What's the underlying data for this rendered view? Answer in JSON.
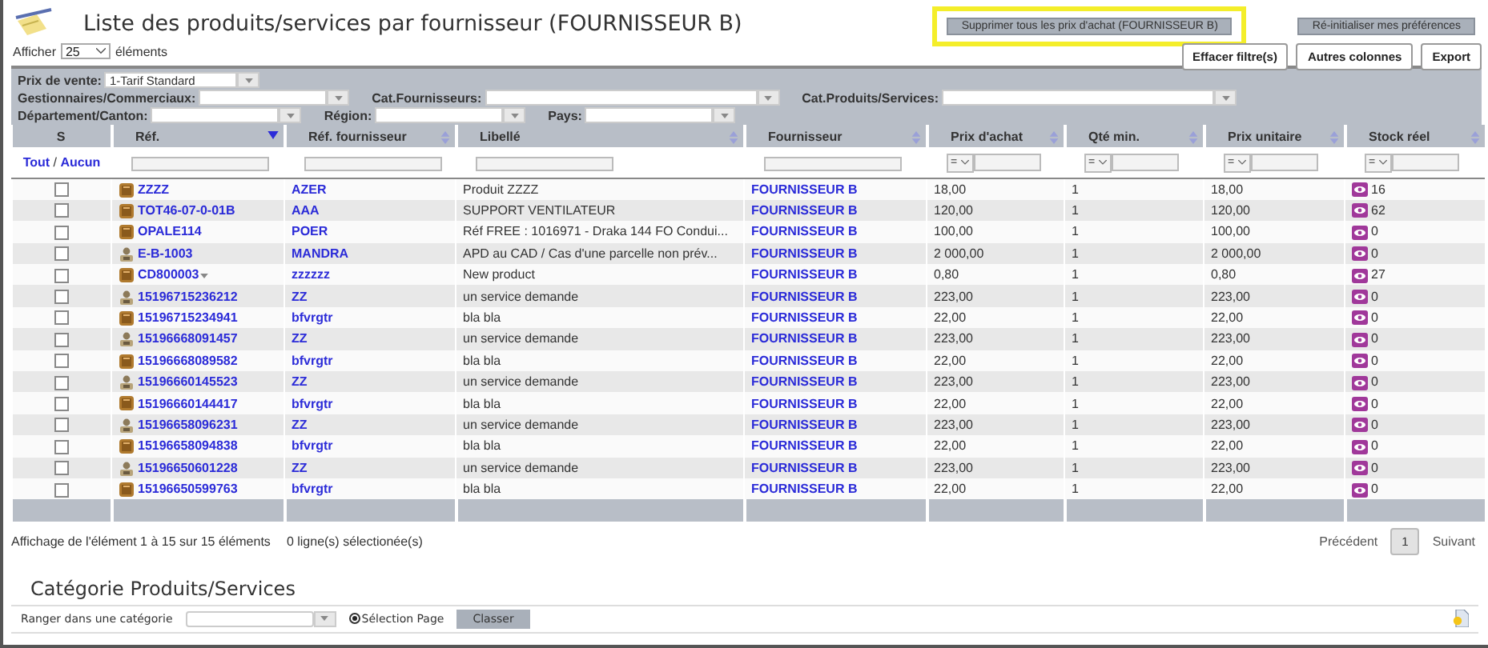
{
  "title": "Liste des produits/services par fournisseur (FOURNISSEUR B)",
  "page_size": {
    "before": "Afficher",
    "value": "25",
    "after": "éléments"
  },
  "top_buttons": [
    {
      "label": "Supprimer tous les prix d'achat (FOURNISSEUR B)",
      "highlighted": true
    },
    {
      "label": "Ré-initialiser mes préférences",
      "highlighted": false
    }
  ],
  "tool_buttons": [
    "Effacer filtre(s)",
    "Autres colonnes",
    "Export"
  ],
  "filter_rows": [
    [
      {
        "label": "Prix de vente:",
        "value": "1-Tarif Standard"
      }
    ],
    [
      {
        "label": "Gestionnaires/Commerciaux:"
      },
      {
        "label": "Cat.Fournisseurs:"
      },
      {
        "label": "Cat.Produits/Services:"
      }
    ],
    [
      {
        "label": "Département/Canton:"
      },
      {
        "label": "Région:"
      },
      {
        "label": "Pays:"
      }
    ]
  ],
  "table": {
    "columns": [
      {
        "label": "S",
        "sortable": false,
        "filter": {
          "kind": "links",
          "links": [
            "Tout",
            "Aucun"
          ],
          "separator": "/"
        }
      },
      {
        "label": "Réf.",
        "sortable": true,
        "sorted": true,
        "filter": {
          "kind": "text"
        }
      },
      {
        "label": "Réf. fournisseur",
        "sortable": true,
        "sorted": false,
        "filter": {
          "kind": "text"
        }
      },
      {
        "label": "Libellé",
        "sortable": true,
        "sorted": false,
        "filter": {
          "kind": "text"
        }
      },
      {
        "label": "Fournisseur",
        "sortable": true,
        "sorted": false,
        "filter": {
          "kind": "text"
        }
      },
      {
        "label": "Prix d'achat",
        "sortable": true,
        "sorted": false,
        "filter": {
          "kind": "compare",
          "operator": "="
        }
      },
      {
        "label": "Qté min.",
        "sortable": true,
        "sorted": false,
        "filter": {
          "kind": "compare",
          "operator": "="
        }
      },
      {
        "label": "Prix unitaire",
        "sortable": true,
        "sorted": false,
        "filter": {
          "kind": "compare",
          "operator": "="
        }
      },
      {
        "label": "Stock réel",
        "sortable": true,
        "sorted": false,
        "filter": {
          "kind": "compare",
          "operator": "="
        }
      }
    ],
    "rows": [
      {
        "checked": false,
        "kind": "product",
        "ref": "ZZZZ",
        "variants": false,
        "supplier_ref": "AZER",
        "label": "Produit ZZZZ",
        "supplier": "FOURNISSEUR B",
        "buy_price": "18,00",
        "min_qty": "1",
        "unit_price": "18,00",
        "stock": "16"
      },
      {
        "checked": false,
        "kind": "product",
        "ref": "TOT46-07-0-01B",
        "variants": false,
        "supplier_ref": "AAA",
        "label": "SUPPORT VENTILATEUR",
        "supplier": "FOURNISSEUR B",
        "buy_price": "120,00",
        "min_qty": "1",
        "unit_price": "120,00",
        "stock": "62"
      },
      {
        "checked": false,
        "kind": "product",
        "ref": "OPALE114",
        "variants": false,
        "supplier_ref": "POER",
        "label": "Réf FREE : 1016971 - Draka 144 FO Condui...",
        "supplier": "FOURNISSEUR B",
        "buy_price": "100,00",
        "min_qty": "1",
        "unit_price": "100,00",
        "stock": "0"
      },
      {
        "checked": false,
        "kind": "service",
        "ref": "E-B-1003",
        "variants": false,
        "supplier_ref": "MANDRA",
        "label": "APD au CAD / Cas d'une parcelle non prév...",
        "supplier": "FOURNISSEUR B",
        "buy_price": "2 000,00",
        "min_qty": "1",
        "unit_price": "2 000,00",
        "stock": "0"
      },
      {
        "checked": false,
        "kind": "product",
        "ref": "CD800003",
        "variants": true,
        "supplier_ref": "zzzzzz",
        "label": "New product",
        "supplier": "FOURNISSEUR B",
        "buy_price": "0,80",
        "min_qty": "1",
        "unit_price": "0,80",
        "stock": "27"
      },
      {
        "checked": false,
        "kind": "service",
        "ref": "15196715236212",
        "variants": false,
        "supplier_ref": "ZZ",
        "label": "un service demande",
        "supplier": "FOURNISSEUR B",
        "buy_price": "223,00",
        "min_qty": "1",
        "unit_price": "223,00",
        "stock": "0"
      },
      {
        "checked": false,
        "kind": "product",
        "ref": "15196715234941",
        "variants": false,
        "supplier_ref": "bfvrgtr",
        "label": "bla bla",
        "supplier": "FOURNISSEUR B",
        "buy_price": "22,00",
        "min_qty": "1",
        "unit_price": "22,00",
        "stock": "0"
      },
      {
        "checked": false,
        "kind": "service",
        "ref": "15196668091457",
        "variants": false,
        "supplier_ref": "ZZ",
        "label": "un service demande",
        "supplier": "FOURNISSEUR B",
        "buy_price": "223,00",
        "min_qty": "1",
        "unit_price": "223,00",
        "stock": "0"
      },
      {
        "checked": false,
        "kind": "product",
        "ref": "15196668089582",
        "variants": false,
        "supplier_ref": "bfvrgtr",
        "label": "bla bla",
        "supplier": "FOURNISSEUR B",
        "buy_price": "22,00",
        "min_qty": "1",
        "unit_price": "22,00",
        "stock": "0"
      },
      {
        "checked": false,
        "kind": "service",
        "ref": "15196660145523",
        "variants": false,
        "supplier_ref": "ZZ",
        "label": "un service demande",
        "supplier": "FOURNISSEUR B",
        "buy_price": "223,00",
        "min_qty": "1",
        "unit_price": "223,00",
        "stock": "0"
      },
      {
        "checked": false,
        "kind": "product",
        "ref": "15196660144417",
        "variants": false,
        "supplier_ref": "bfvrgtr",
        "label": "bla bla",
        "supplier": "FOURNISSEUR B",
        "buy_price": "22,00",
        "min_qty": "1",
        "unit_price": "22,00",
        "stock": "0"
      },
      {
        "checked": false,
        "kind": "service",
        "ref": "15196658096231",
        "variants": false,
        "supplier_ref": "ZZ",
        "label": "un service demande",
        "supplier": "FOURNISSEUR B",
        "buy_price": "223,00",
        "min_qty": "1",
        "unit_price": "223,00",
        "stock": "0"
      },
      {
        "checked": false,
        "kind": "product",
        "ref": "15196658094838",
        "variants": false,
        "supplier_ref": "bfvrgtr",
        "label": "bla bla",
        "supplier": "FOURNISSEUR B",
        "buy_price": "22,00",
        "min_qty": "1",
        "unit_price": "22,00",
        "stock": "0"
      },
      {
        "checked": false,
        "kind": "service",
        "ref": "15196650601228",
        "variants": false,
        "supplier_ref": "ZZ",
        "label": "un service demande",
        "supplier": "FOURNISSEUR B",
        "buy_price": "223,00",
        "min_qty": "1",
        "unit_price": "223,00",
        "stock": "0"
      },
      {
        "checked": false,
        "kind": "product",
        "ref": "15196650599763",
        "variants": false,
        "supplier_ref": "bfvrgtr",
        "label": "bla bla",
        "supplier": "FOURNISSEUR B",
        "buy_price": "22,00",
        "min_qty": "1",
        "unit_price": "22,00",
        "stock": "0"
      }
    ]
  },
  "info": {
    "range": "Affichage de l'élément 1 à 15 sur 15 éléments",
    "selected": "0 ligne(s) sélectionée(s)"
  },
  "pagination": {
    "previous": "Précédent",
    "pages": [
      {
        "label": "1",
        "selected": true
      }
    ],
    "next": "Suivant"
  },
  "category": {
    "title": "Catégorie Produits/Services",
    "label": "Ranger dans une catégorie",
    "radio": {
      "label": "Sélection Page",
      "checked": true
    },
    "button": "Classer"
  }
}
